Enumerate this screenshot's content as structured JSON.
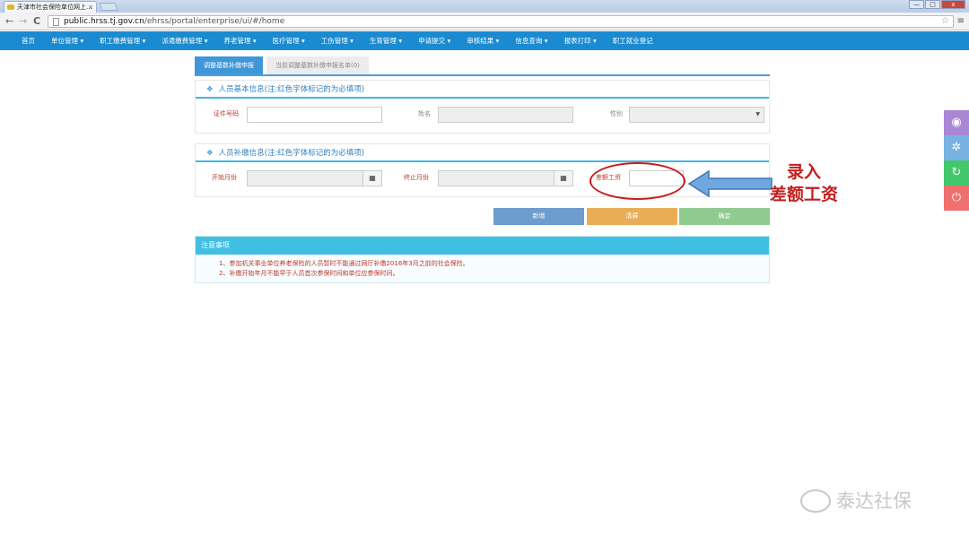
{
  "browser": {
    "tab_title": "天津市社会保险单位网上...",
    "tab_close": "×",
    "url_host": "public.hrss.tj.gov.cn",
    "url_path": "/ehrss/portal/enterprise/ui/#/home",
    "back": "←",
    "forward": "→",
    "reload": "C",
    "star": "☆",
    "menu": "≡",
    "win_min": "—",
    "win_max": "□",
    "win_close": "x"
  },
  "nav": {
    "items": [
      "首页",
      "单位管理 ▾",
      "职工缴费管理 ▾",
      "派遣缴费管理 ▾",
      "养老管理 ▾",
      "医疗管理 ▾",
      "工伤管理 ▾",
      "生育管理 ▾",
      "申请提交 ▾",
      "审核结果 ▾",
      "信息查询 ▾",
      "报表打印 ▾",
      "职工就业登记"
    ]
  },
  "tabs": {
    "active": "调整基数补缴申报",
    "inactive": "当前调整基数补缴申报名单(0)"
  },
  "basic_panel": {
    "title": "人员基本信息(注:红色字体标记的为必填项)",
    "id_label": "证件号码",
    "name_label": "姓名",
    "gender_label": "性别"
  },
  "supp_panel": {
    "title": "人员补缴信息(注:红色字体标记的为必填项)",
    "start_label": "开始月份",
    "end_label": "终止月份",
    "diff_label": "差额工资"
  },
  "buttons": {
    "add": "新增",
    "clear": "清屏",
    "confirm": "确定"
  },
  "notice": {
    "title": "注意事项",
    "items": [
      "1、参加机关事业单位养老保险的人员暂时不能通过网厅补缴2016年3月之前的社会保险。",
      "2、补缴开始年月不能早于人员首次参保时间和单位应参保时间。"
    ]
  },
  "annotation": {
    "line1": "录入",
    "line2": "差额工资",
    "color": "#c41e1e"
  },
  "watermark": {
    "text": "泰达社保"
  },
  "colors": {
    "nav_bg": "#1a8bd0",
    "tab_active": "#3f97da",
    "notice_head": "#3fc0e3",
    "required_label": "#c0392b"
  }
}
